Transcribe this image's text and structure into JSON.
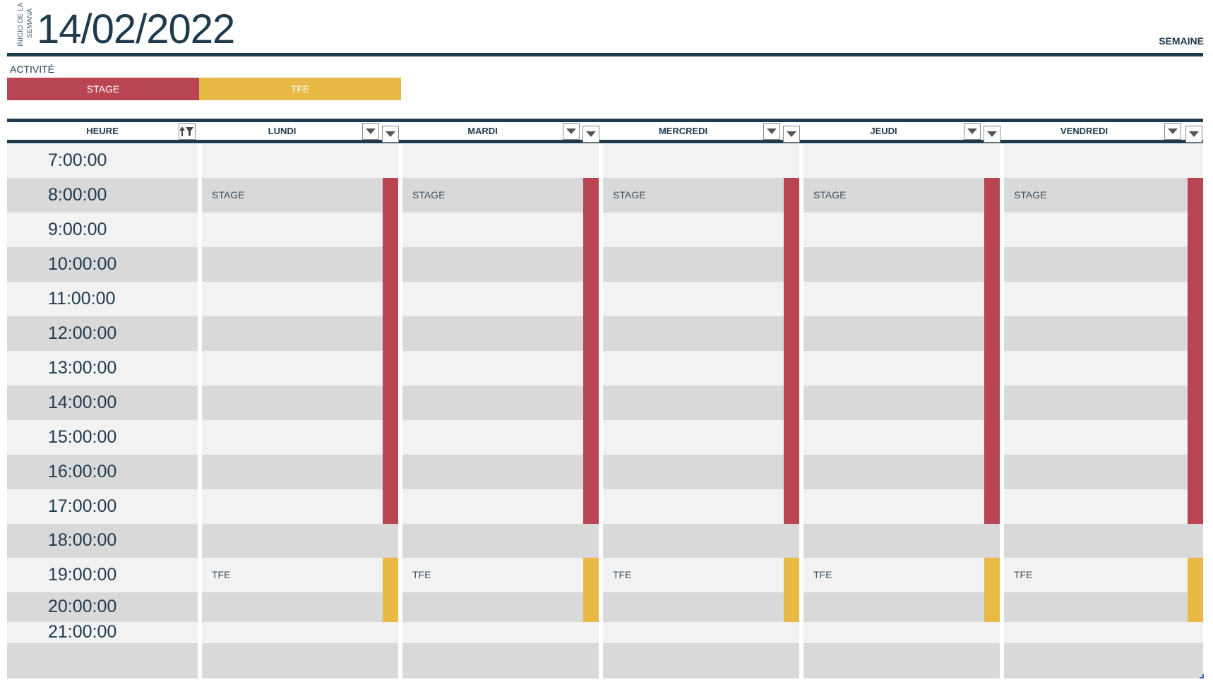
{
  "header": {
    "start_label_line1": "INICIO DE LA",
    "start_label_line2": "SEMANA",
    "date": "14/02/2022",
    "view_label": "SEMAINE"
  },
  "legend": {
    "title": "ACTIVITÉ",
    "items": [
      {
        "label": "STAGE",
        "color": "#b94452"
      },
      {
        "label": "TFE",
        "color": "#e8b944"
      }
    ]
  },
  "table": {
    "hour_header": "HEURE",
    "days": [
      "LUNDI",
      "MARDI",
      "MERCREDI",
      "JEUDI",
      "VENDREDI"
    ],
    "hours": [
      "7:00:00",
      "8:00:00",
      "9:00:00",
      "10:00:00",
      "11:00:00",
      "12:00:00",
      "13:00:00",
      "14:00:00",
      "15:00:00",
      "16:00:00",
      "17:00:00",
      "18:00:00",
      "19:00:00",
      "20:00:00",
      "21:00:00"
    ],
    "events": [
      {
        "label": "STAGE",
        "start": "8:00:00",
        "end": "17:00:00",
        "color": "#b94452"
      },
      {
        "label": "TFE",
        "start": "19:00:00",
        "end": "20:00:00",
        "color": "#e8b944"
      }
    ]
  },
  "colors": {
    "navy": "#1f3a4d",
    "row_light": "#f2f2f2",
    "row_dark": "#d9d9d9"
  }
}
